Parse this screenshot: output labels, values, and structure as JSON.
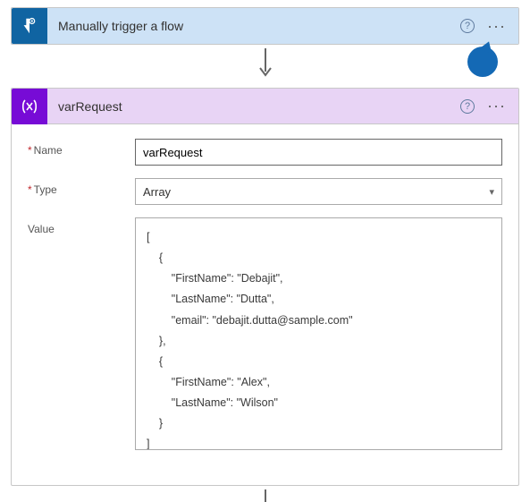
{
  "trigger": {
    "title": "Manually trigger a flow"
  },
  "action": {
    "title": "varRequest"
  },
  "form": {
    "nameLabel": "Name",
    "typeLabel": "Type",
    "valueLabel": "Value",
    "nameValue": "varRequest",
    "typeValue": "Array",
    "valueContent": "[\n    {\n        \"FirstName\": \"Debajit\",\n        \"LastName\": \"Dutta\",\n        \"email\": \"debajit.dutta@sample.com\"\n    },\n    {\n        \"FirstName\": \"Alex\",\n        \"LastName\": \"Wilson\"\n    }\n]"
  },
  "icons": {
    "help": "?",
    "more": "···"
  }
}
